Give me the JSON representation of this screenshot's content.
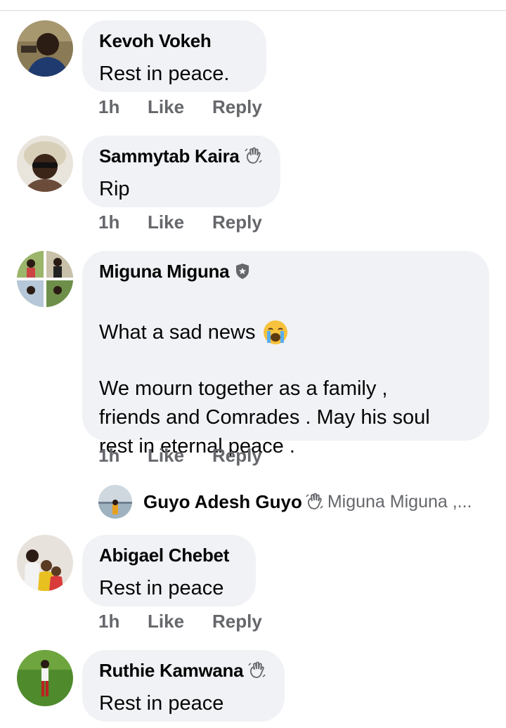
{
  "comments": [
    {
      "author": "Kevoh Vokeh",
      "text": "Rest in peace.",
      "time": "1h",
      "like": "Like",
      "reply": "Reply",
      "badge": null
    },
    {
      "author": "Sammytab Kaira",
      "text": "Rip",
      "time": "1h",
      "like": "Like",
      "reply": "Reply",
      "badge": "waving-hand-icon"
    },
    {
      "author": "Miguna Miguna",
      "text_line1": "What a sad news",
      "text_rest": "We mourn together as a family ,\nfriends and Comrades . May his soul\nrest in eternal peace .",
      "time": "1h",
      "like": "Like",
      "reply": "Reply",
      "badge": "shield-star-icon",
      "emoji": "😭"
    },
    {
      "author": "Abigael Chebet",
      "text": "Rest in peace",
      "time": "1h",
      "like": "Like",
      "reply": "Reply",
      "badge": null
    },
    {
      "author": "Ruthie Kamwana",
      "text": "Rest in peace",
      "badge": "waving-hand-icon"
    }
  ],
  "reply_preview": {
    "author": "Guyo Adesh Guyo",
    "snippet": "Miguna Miguna ,...",
    "badge": "waving-hand-icon"
  },
  "colors": {
    "bubble": "#f0f2f5",
    "meta_text": "#65676b",
    "name_text": "#050505"
  }
}
